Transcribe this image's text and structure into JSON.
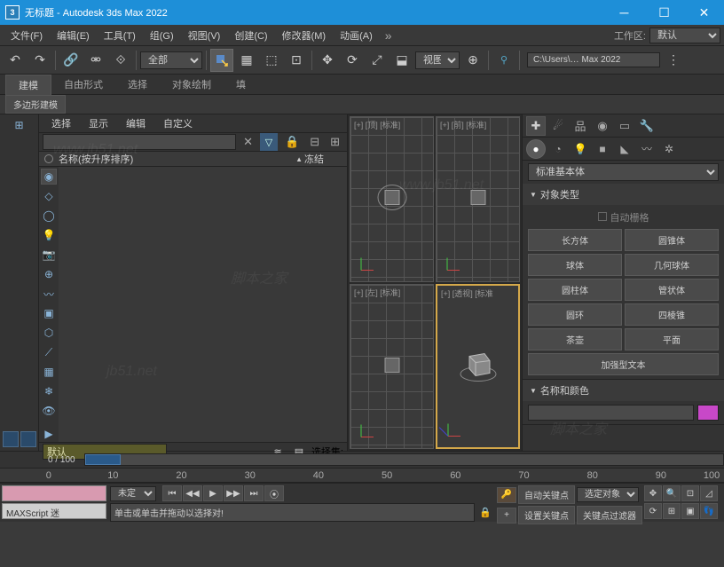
{
  "titlebar": {
    "app_icon": "3",
    "title": "无标题 - Autodesk 3ds Max 2022"
  },
  "menubar": {
    "items": [
      "文件(F)",
      "编辑(E)",
      "工具(T)",
      "组(G)",
      "视图(V)",
      "创建(C)",
      "修改器(M)",
      "动画(A)"
    ],
    "workspace_label": "工作区:",
    "workspace_value": "默认"
  },
  "toolbar": {
    "filter": "全部",
    "view_label": "视图",
    "path": "C:\\Users\\… Max 2022"
  },
  "ribbon": {
    "tabs": [
      "建模",
      "自由形式",
      "选择",
      "对象绘制",
      "填"
    ],
    "subtab": "多边形建模"
  },
  "scenepanel": {
    "tabs": [
      "选择",
      "显示",
      "编辑",
      "自定义"
    ],
    "search_placeholder": "",
    "header": {
      "name": "名称(按升序排序)",
      "freeze": "冻结"
    },
    "footer": {
      "layer": "默认",
      "setlabel": "选择集:"
    }
  },
  "viewports": {
    "tl": "[+] [顶] [标准]",
    "tr": "[+] [前] [标准]",
    "bl": "[+] [左] [标准]",
    "br": "[+] [透视] [标准"
  },
  "cmdpanel": {
    "dropdown": "标准基本体",
    "rollout1": {
      "title": "对象类型",
      "autogrid": "自动栅格",
      "buttons": [
        "长方体",
        "圆锥体",
        "球体",
        "几何球体",
        "圆柱体",
        "管状体",
        "圆环",
        "四棱锥",
        "茶壶",
        "平面",
        "加强型文本"
      ]
    },
    "rollout2": {
      "title": "名称和颜色",
      "name": ""
    }
  },
  "timeline": {
    "frame": "0 / 100",
    "ticks": [
      "0",
      "10",
      "20",
      "30",
      "40",
      "50",
      "60",
      "70",
      "80",
      "90",
      "100"
    ]
  },
  "bottom": {
    "script": "MAXScript 迷",
    "undef": "未定",
    "prompt": "单击或单击并拖动以选择对!",
    "autokey": "自动关键点",
    "selobj": "选定对象",
    "setkey": "设置关键点",
    "keyfilter": "关键点过滤器"
  }
}
